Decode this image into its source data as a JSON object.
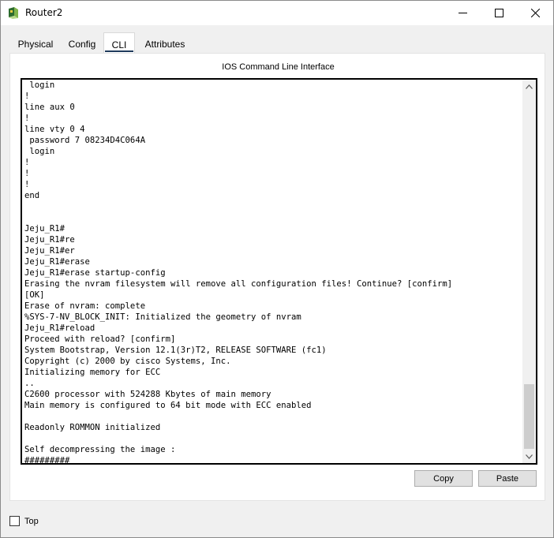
{
  "window": {
    "title": "Router2",
    "minimize_glyph": "—",
    "maximize_glyph": "☐",
    "close_glyph": "✕"
  },
  "tabs": [
    {
      "label": "Physical"
    },
    {
      "label": "Config"
    },
    {
      "label": "CLI",
      "active": true
    },
    {
      "label": "Attributes"
    }
  ],
  "cli": {
    "heading": "IOS Command Line Interface",
    "lines": [
      " login",
      "!",
      "line aux 0",
      "!",
      "line vty 0 4",
      " password 7 08234D4C064A",
      " login",
      "!",
      "!",
      "!",
      "end",
      "",
      "",
      "Jeju_R1#",
      "Jeju_R1#re",
      "Jeju_R1#er",
      "Jeju_R1#erase",
      "Jeju_R1#erase startup-config",
      "Erasing the nvram filesystem will remove all configuration files! Continue? [confirm]",
      "[OK]",
      "Erase of nvram: complete",
      "%SYS-7-NV_BLOCK_INIT: Initialized the geometry of nvram",
      "Jeju_R1#reload",
      "Proceed with reload? [confirm]",
      "System Bootstrap, Version 12.1(3r)T2, RELEASE SOFTWARE (fc1)",
      "Copyright (c) 2000 by cisco Systems, Inc.",
      "Initializing memory for ECC",
      "..",
      "C2600 processor with 524288 Kbytes of main memory",
      "Main memory is configured to 64 bit mode with ECC enabled",
      "",
      "Readonly ROMMON initialized",
      "",
      "Self decompressing the image :",
      "#########"
    ],
    "copy_label": "Copy",
    "paste_label": "Paste"
  },
  "footer": {
    "top_label": "Top",
    "top_checked": false
  },
  "icons": {
    "app": "router-app-icon",
    "scroll_up": "chevron-up-icon",
    "scroll_down": "chevron-down-icon"
  }
}
